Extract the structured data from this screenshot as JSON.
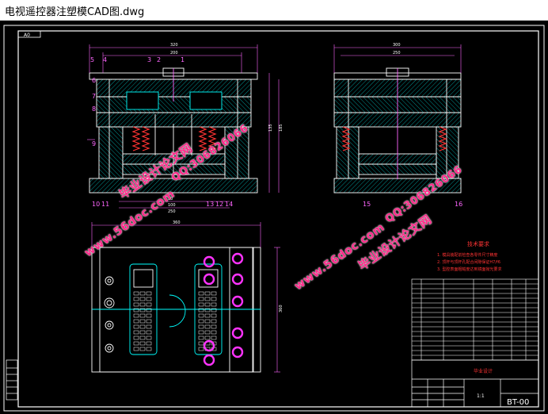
{
  "window": {
    "title": "电视遥控器注塑模CAD图.dwg"
  },
  "drawing": {
    "sheet_size": "A0",
    "dims": {
      "front_width": "320",
      "front_inner": "200",
      "side_width": "300",
      "side_inner": "250",
      "height_a": "135",
      "height_b": "185",
      "bottom_a": "30",
      "bottom_b": "100",
      "bottom_c": "250",
      "top_plan": "360",
      "plan_h": "360"
    },
    "part_labels": [
      "5",
      "4",
      "3",
      "2",
      "1",
      "6",
      "7",
      "8",
      "9",
      "10",
      "11",
      "12",
      "13",
      "14",
      "15",
      "16"
    ],
    "tech_req_title": "技术要求",
    "tech_req_lines": [
      "1. 模具装配前检查各零件尺寸精度",
      "2. 顶杆与顶杆孔配合间隙保证H7/f6",
      "3. 型腔表面粗糙度达到镜面抛光要求"
    ],
    "bom_rows": 17,
    "title_block": {
      "school": "毕业设计",
      "drawing_no": "BT-00",
      "scale": "1:1"
    }
  },
  "watermarks": {
    "site": "www.56doc.com",
    "brand": "毕业设计论文网",
    "qq": "QQ:306826066"
  },
  "colors": {
    "background": "#000000",
    "outline": "#ffffff",
    "dim_line": "#ff66ff",
    "mold_line": "#00ffff",
    "hatch": "#00c8c8",
    "red_text": "#ff3333",
    "yellow_text": "#ffff00",
    "spring": "#ff3333",
    "watermark": "#ff2a8a"
  }
}
